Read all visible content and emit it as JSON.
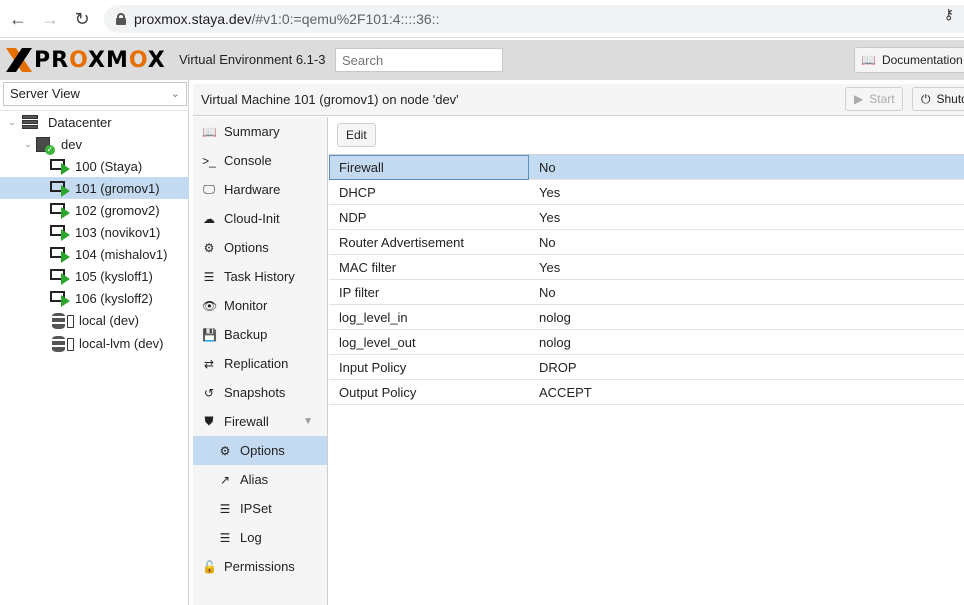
{
  "browser": {
    "url_host": "proxmox.staya.dev",
    "url_rest": "/#v1:0:=qemu%2F101:4::::36::"
  },
  "header": {
    "logo_text": "PROXMOX",
    "version": "Virtual Environment 6.1-3",
    "search_placeholder": "Search",
    "documentation_label": "Documentation"
  },
  "tree": {
    "view_select": "Server View",
    "datacenter": "Datacenter",
    "node": "dev",
    "vms": [
      {
        "label": "100 (Staya)"
      },
      {
        "label": "101 (gromov1)",
        "selected": true
      },
      {
        "label": "102 (gromov2)"
      },
      {
        "label": "103 (novikov1)"
      },
      {
        "label": "104 (mishalov1)"
      },
      {
        "label": "105 (kysloff1)"
      },
      {
        "label": "106 (kysloff2)"
      }
    ],
    "storages": [
      {
        "label": "local (dev)"
      },
      {
        "label": "local-lvm (dev)"
      }
    ]
  },
  "content": {
    "title": "Virtual Machine 101 (gromov1) on node 'dev'",
    "start_label": "Start",
    "shutdown_label": "Shutdown"
  },
  "nav": {
    "items": [
      {
        "label": "Summary",
        "icon": "book-icon"
      },
      {
        "label": "Console",
        "icon": "terminal-icon"
      },
      {
        "label": "Hardware",
        "icon": "desktop-icon"
      },
      {
        "label": "Cloud-Init",
        "icon": "cloud-icon"
      },
      {
        "label": "Options",
        "icon": "gear-icon"
      },
      {
        "label": "Task History",
        "icon": "list-icon"
      },
      {
        "label": "Monitor",
        "icon": "eye-icon"
      },
      {
        "label": "Backup",
        "icon": "floppy-icon"
      },
      {
        "label": "Replication",
        "icon": "retweet-icon"
      },
      {
        "label": "Snapshots",
        "icon": "history-icon"
      },
      {
        "label": "Firewall",
        "icon": "shield-icon"
      },
      {
        "label": "Options",
        "icon": "gear-icon",
        "child": true,
        "selected": true
      },
      {
        "label": "Alias",
        "icon": "external-link-icon",
        "child": true
      },
      {
        "label": "IPSet",
        "icon": "list-ol-icon",
        "child": true
      },
      {
        "label": "Log",
        "icon": "list-icon",
        "child": true
      },
      {
        "label": "Permissions",
        "icon": "unlock-icon"
      }
    ]
  },
  "grid": {
    "edit_label": "Edit",
    "rows": [
      {
        "key": "Firewall",
        "value": "No"
      },
      {
        "key": "DHCP",
        "value": "Yes"
      },
      {
        "key": "NDP",
        "value": "Yes"
      },
      {
        "key": "Router Advertisement",
        "value": "No"
      },
      {
        "key": "MAC filter",
        "value": "Yes"
      },
      {
        "key": "IP filter",
        "value": "No"
      },
      {
        "key": "log_level_in",
        "value": "nolog"
      },
      {
        "key": "log_level_out",
        "value": "nolog"
      },
      {
        "key": "Input Policy",
        "value": "DROP"
      },
      {
        "key": "Output Policy",
        "value": "ACCEPT"
      }
    ]
  },
  "colors": {
    "accent_orange": "#e57000",
    "selection": "#c3daf0",
    "running_green": "#2ea52e"
  }
}
